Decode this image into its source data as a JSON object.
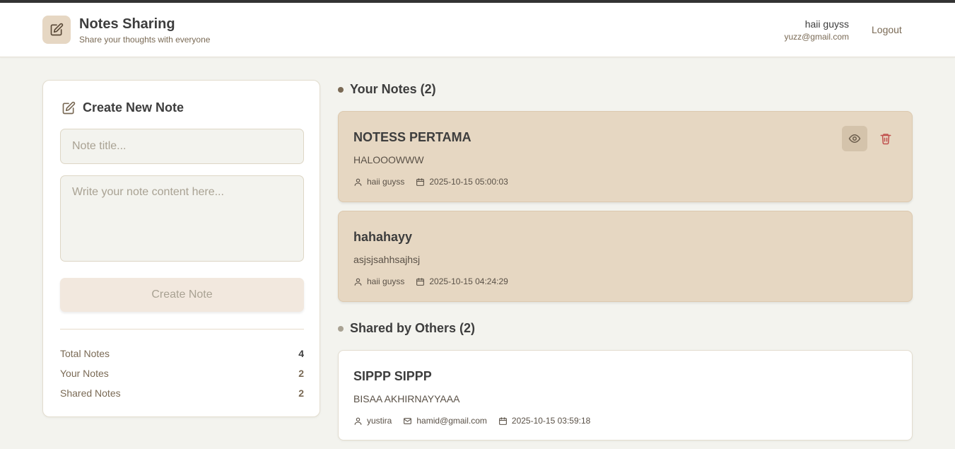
{
  "app": {
    "title": "Notes Sharing",
    "subtitle": "Share your thoughts with everyone"
  },
  "user": {
    "name": "haii guyss",
    "email": "yuzz@gmail.com",
    "logout_label": "Logout"
  },
  "create": {
    "heading": "Create New Note",
    "title_placeholder": "Note title...",
    "content_placeholder": "Write your note content here...",
    "button_label": "Create Note"
  },
  "stats": [
    {
      "label": "Total Notes",
      "value": "4",
      "color": "#3d3d3d"
    },
    {
      "label": "Your Notes",
      "value": "2",
      "color": "#7a6a55"
    },
    {
      "label": "Shared Notes",
      "value": "2",
      "color": "#7a6a55"
    }
  ],
  "your_notes": {
    "heading": "Your Notes (2)",
    "dot_color": "#7a6a55",
    "notes": [
      {
        "title": "NOTESS PERTAMA",
        "body": "HALOOOWWW",
        "author": "haii guyss",
        "date": "2025-10-15 05:00:03"
      },
      {
        "title": "hahahayy",
        "body": "asjsjsahhsajhsj",
        "author": "haii guyss",
        "date": "2025-10-15 04:24:29"
      }
    ]
  },
  "shared_notes": {
    "heading": "Shared by Others (2)",
    "dot_color": "#a9a293",
    "notes": [
      {
        "title": "SIPPP SIPPP",
        "body": "BISAA AKHIRNAYYAAA",
        "author": "yustira",
        "email": "hamid@gmail.com",
        "date": "2025-10-15 03:59:18"
      }
    ]
  },
  "colors": {
    "accent": "#7a6a55",
    "own_card": "#e6d7c2",
    "delete": "#c0504d",
    "background": "#f3f3ee"
  }
}
